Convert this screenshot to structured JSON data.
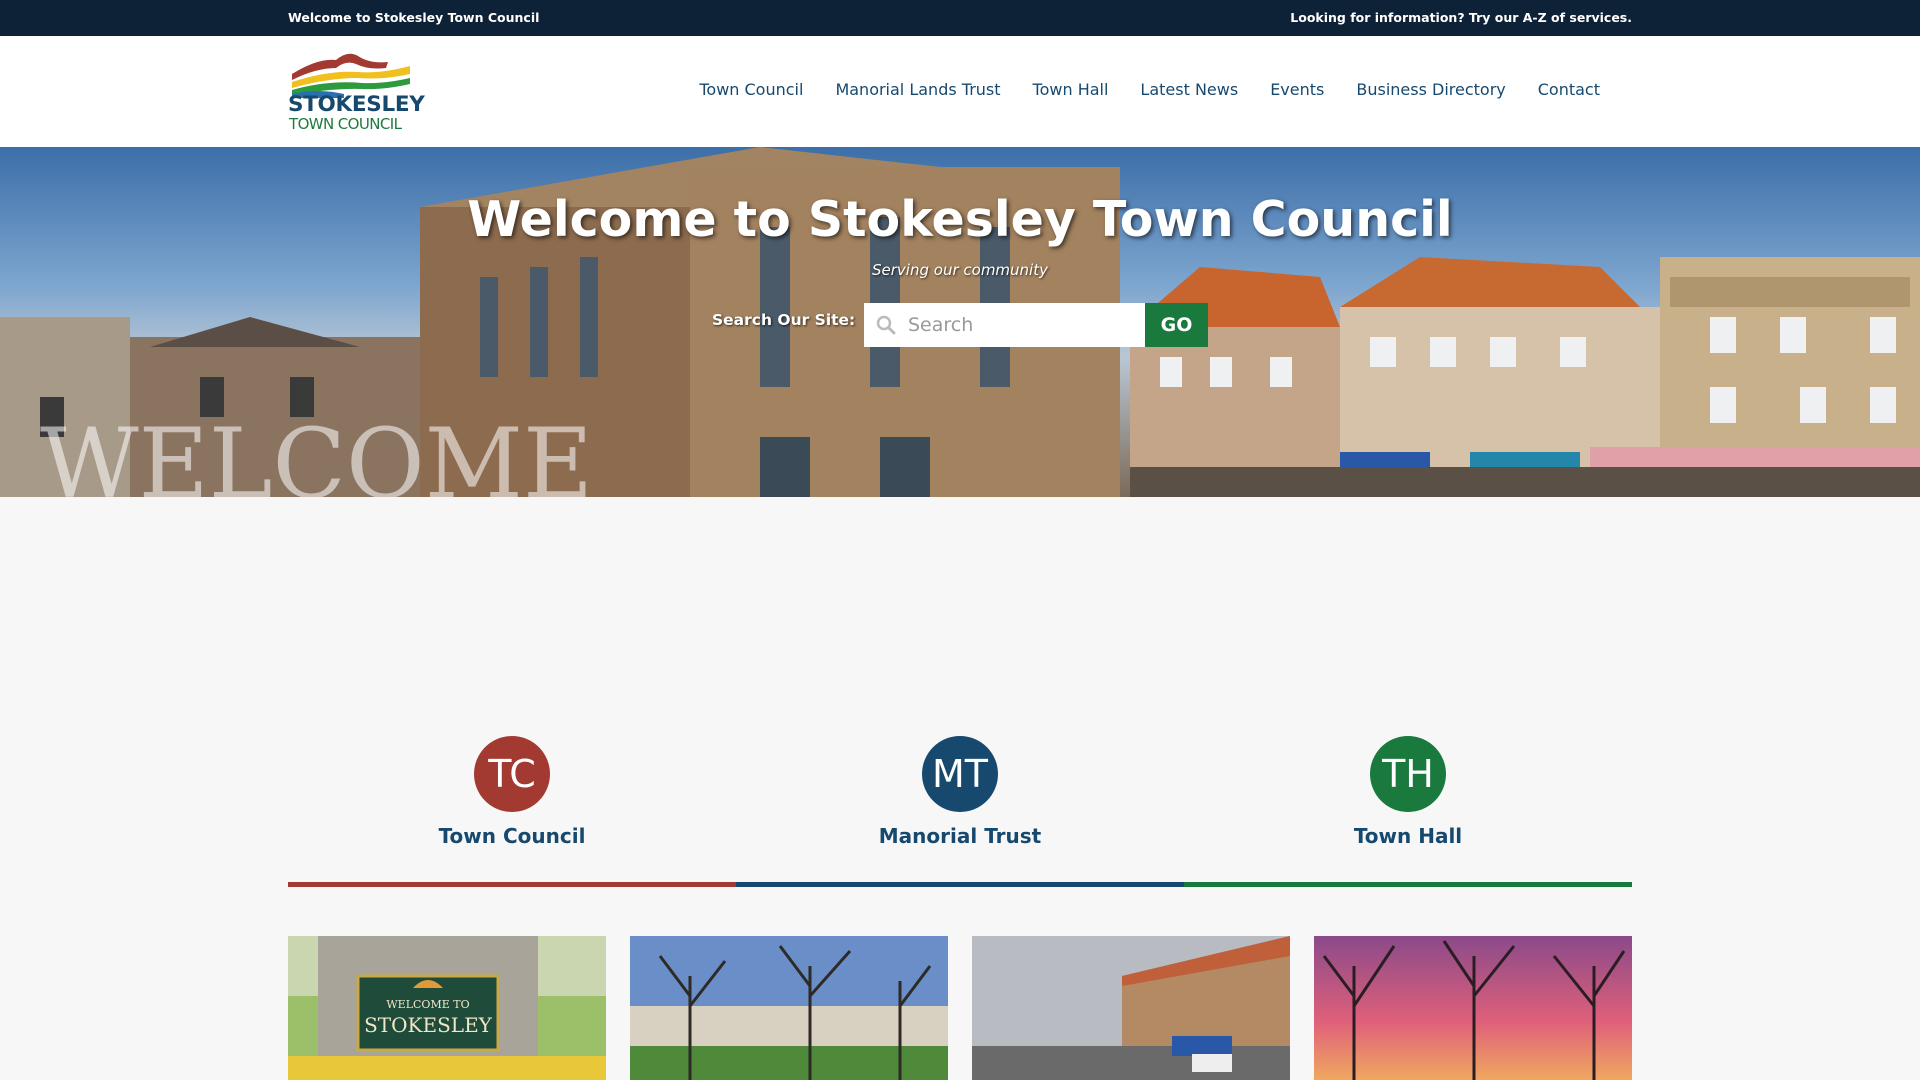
{
  "topbar": {
    "left_text": "Welcome to Stokesley Town Council",
    "right_text": "Looking for information? Try our A-Z of services."
  },
  "logo": {
    "line1": "STOKESLEY",
    "line2": "TOWN COUNCIL"
  },
  "nav": [
    {
      "label": "Town Council"
    },
    {
      "label": "Manorial Lands Trust"
    },
    {
      "label": "Town Hall"
    },
    {
      "label": "Latest News"
    },
    {
      "label": "Events"
    },
    {
      "label": "Business Directory"
    },
    {
      "label": "Contact"
    }
  ],
  "hero": {
    "title": "Welcome to Stokesley Town Council",
    "subtitle": "Serving our community",
    "search_label": "Search Our Site:",
    "search_placeholder": "Search",
    "go_label": "GO"
  },
  "features": [
    {
      "initials": "TC",
      "label": "Town Council",
      "color": "#a23a32"
    },
    {
      "initials": "MT",
      "label": "Manorial Trust",
      "color": "#17496f"
    },
    {
      "initials": "TH",
      "label": "Town Hall",
      "color": "#1a7a3e"
    }
  ],
  "thumbnails": [
    {
      "sign_line1": "WELCOME TO",
      "sign_line2": "STOKESLEY"
    }
  ],
  "colors": {
    "topbar": "#0e2237",
    "brand_blue": "#17496f",
    "brand_green": "#1a7a3e",
    "brand_red": "#a23a32"
  }
}
